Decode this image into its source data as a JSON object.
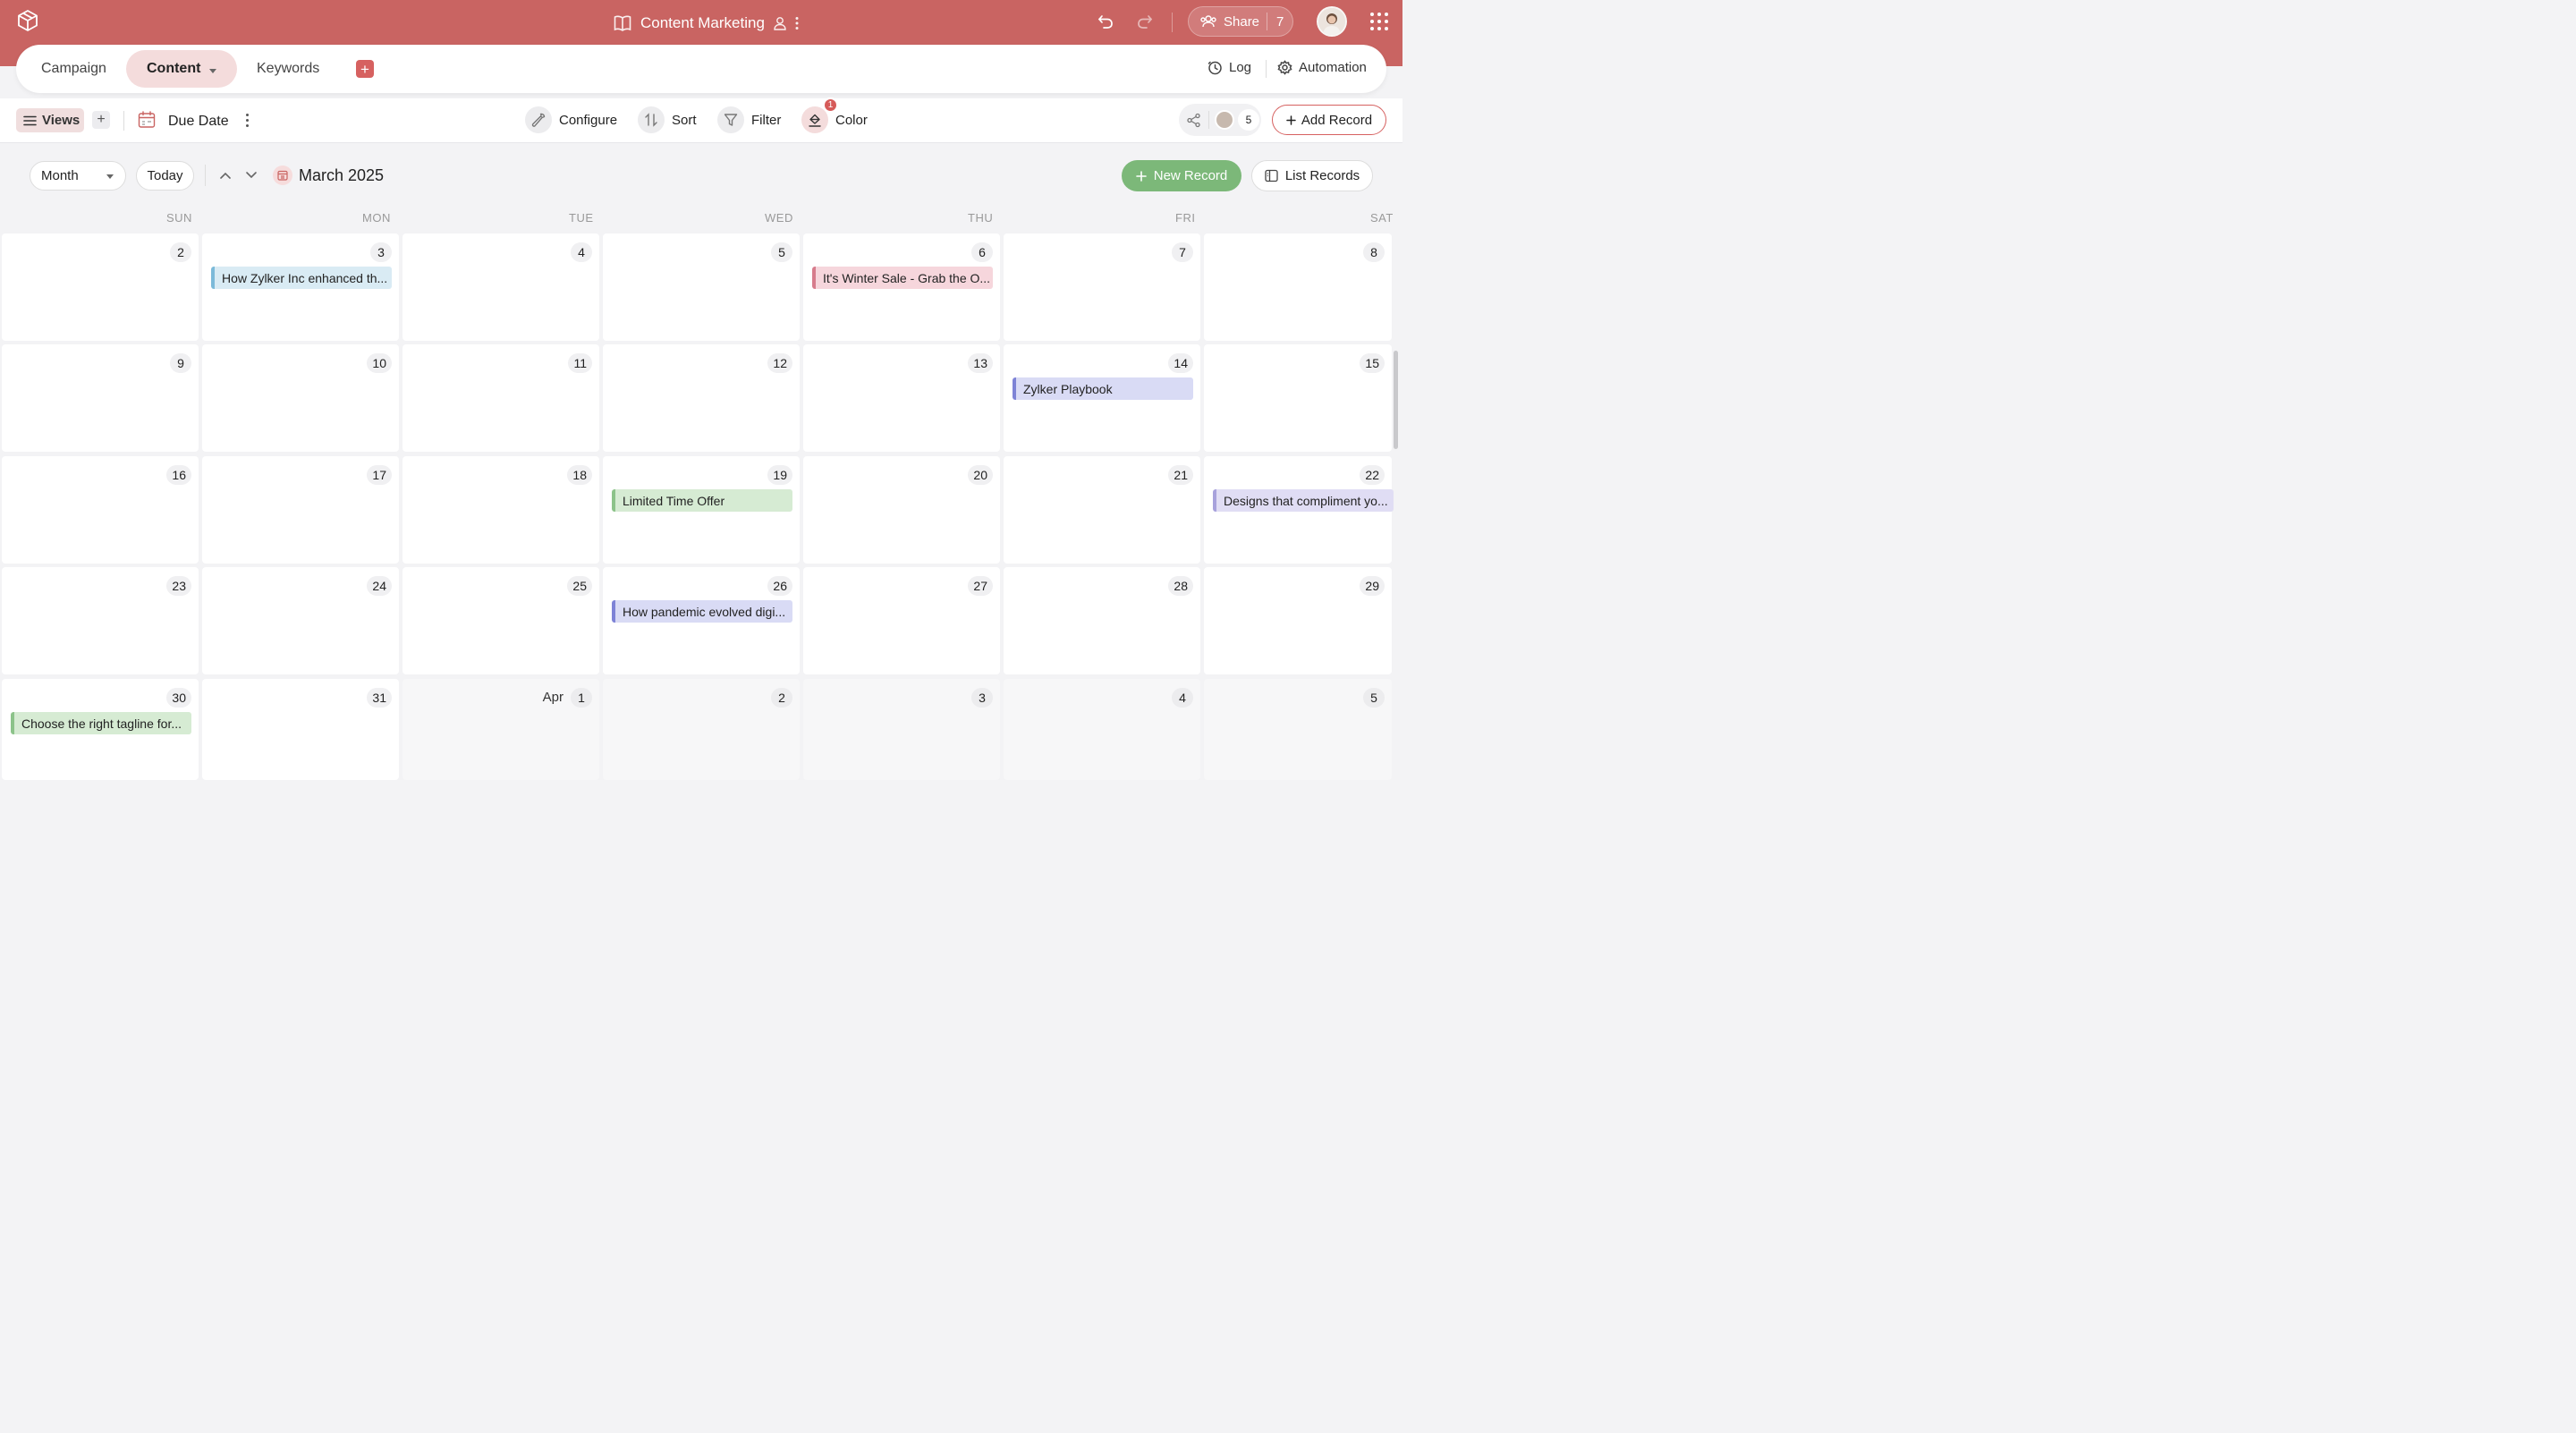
{
  "app": {
    "title": "Content Marketing",
    "share_label": "Share",
    "share_count": "7",
    "brand_color": "#c96462"
  },
  "tabs": [
    {
      "label": "Campaign",
      "active": false
    },
    {
      "label": "Content",
      "active": true
    },
    {
      "label": "Keywords",
      "active": false
    }
  ],
  "tabbar_right": {
    "log": "Log",
    "automation": "Automation"
  },
  "toolbar": {
    "views": "Views",
    "date_field": "Due Date",
    "configure": "Configure",
    "sort": "Sort",
    "filter": "Filter",
    "color": "Color",
    "color_badge": "1",
    "collaborators": "5",
    "add_record": "Add Record"
  },
  "calendar": {
    "view_select": "Month",
    "today": "Today",
    "current_month": "March 2025",
    "new_record": "New Record",
    "list_records": "List Records",
    "weekdays": [
      "SUN",
      "MON",
      "TUE",
      "WED",
      "THU",
      "FRI",
      "SAT"
    ],
    "weeks": [
      [
        {
          "day": "2"
        },
        {
          "day": "3",
          "event": {
            "title": "How Zylker Inc enhanced th...",
            "color": "#7cbad9",
            "bg": "#d9ebf4"
          }
        },
        {
          "day": "4"
        },
        {
          "day": "5"
        },
        {
          "day": "6",
          "event": {
            "title": "It's Winter Sale - Grab the O...",
            "color": "#d77c8c",
            "bg": "#f6d6dc"
          }
        },
        {
          "day": "7"
        },
        {
          "day": "8"
        }
      ],
      [
        {
          "day": "9"
        },
        {
          "day": "10"
        },
        {
          "day": "11"
        },
        {
          "day": "12"
        },
        {
          "day": "13"
        },
        {
          "day": "14",
          "event": {
            "title": "Zylker Playbook",
            "color": "#7e83d6",
            "bg": "#d9dbf5"
          }
        },
        {
          "day": "15"
        }
      ],
      [
        {
          "day": "16"
        },
        {
          "day": "17"
        },
        {
          "day": "18"
        },
        {
          "day": "19",
          "event": {
            "title": "Limited Time Offer",
            "color": "#8cc38a",
            "bg": "#d6ebd3"
          }
        },
        {
          "day": "20"
        },
        {
          "day": "21"
        },
        {
          "day": "22",
          "event": {
            "title": "Designs that compliment yo...",
            "color": "#a8a2dc",
            "bg": "#e0ddf4"
          }
        }
      ],
      [
        {
          "day": "23"
        },
        {
          "day": "24"
        },
        {
          "day": "25"
        },
        {
          "day": "26",
          "event": {
            "title": "How pandemic evolved digi...",
            "color": "#7e83d6",
            "bg": "#d9dbf5"
          }
        },
        {
          "day": "27"
        },
        {
          "day": "28"
        },
        {
          "day": "29"
        }
      ],
      [
        {
          "day": "30",
          "event": {
            "title": "Choose the right tagline for...",
            "color": "#8cc38a",
            "bg": "#d6ebd3"
          }
        },
        {
          "day": "31"
        },
        {
          "day": "1",
          "month_label": "Apr",
          "other_month": true
        },
        {
          "day": "2",
          "other_month": true
        },
        {
          "day": "3",
          "other_month": true
        },
        {
          "day": "4",
          "other_month": true
        },
        {
          "day": "5",
          "other_month": true
        }
      ]
    ]
  }
}
